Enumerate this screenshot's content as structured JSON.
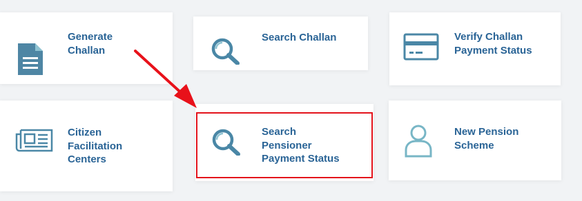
{
  "tiles": [
    {
      "id": "generate-challan",
      "label": "Generate\nChallan",
      "icon": "document-icon"
    },
    {
      "id": "search-challan",
      "label": "Search Challan",
      "icon": "search-icon"
    },
    {
      "id": "verify-challan",
      "label": "Verify Challan\nPayment Status",
      "icon": "credit-card-icon"
    },
    {
      "id": "citizen-facilitation",
      "label": "Citizen\nFacilitation\nCenters",
      "icon": "newspaper-icon"
    },
    {
      "id": "search-pensioner",
      "label": "Search\nPensioner\nPayment Status",
      "icon": "search-icon"
    },
    {
      "id": "new-pension",
      "label": "New Pension\nScheme",
      "icon": "user-icon"
    }
  ],
  "annotation": {
    "highlight": "search-pensioner",
    "pointer": "arrow-icon"
  },
  "colors": {
    "background": "#f1f3f5",
    "card": "#ffffff",
    "label": "#2a6496",
    "icon_dark": "#4a7f9e",
    "icon_light": "#78b6c6",
    "highlight": "#e3121b"
  }
}
